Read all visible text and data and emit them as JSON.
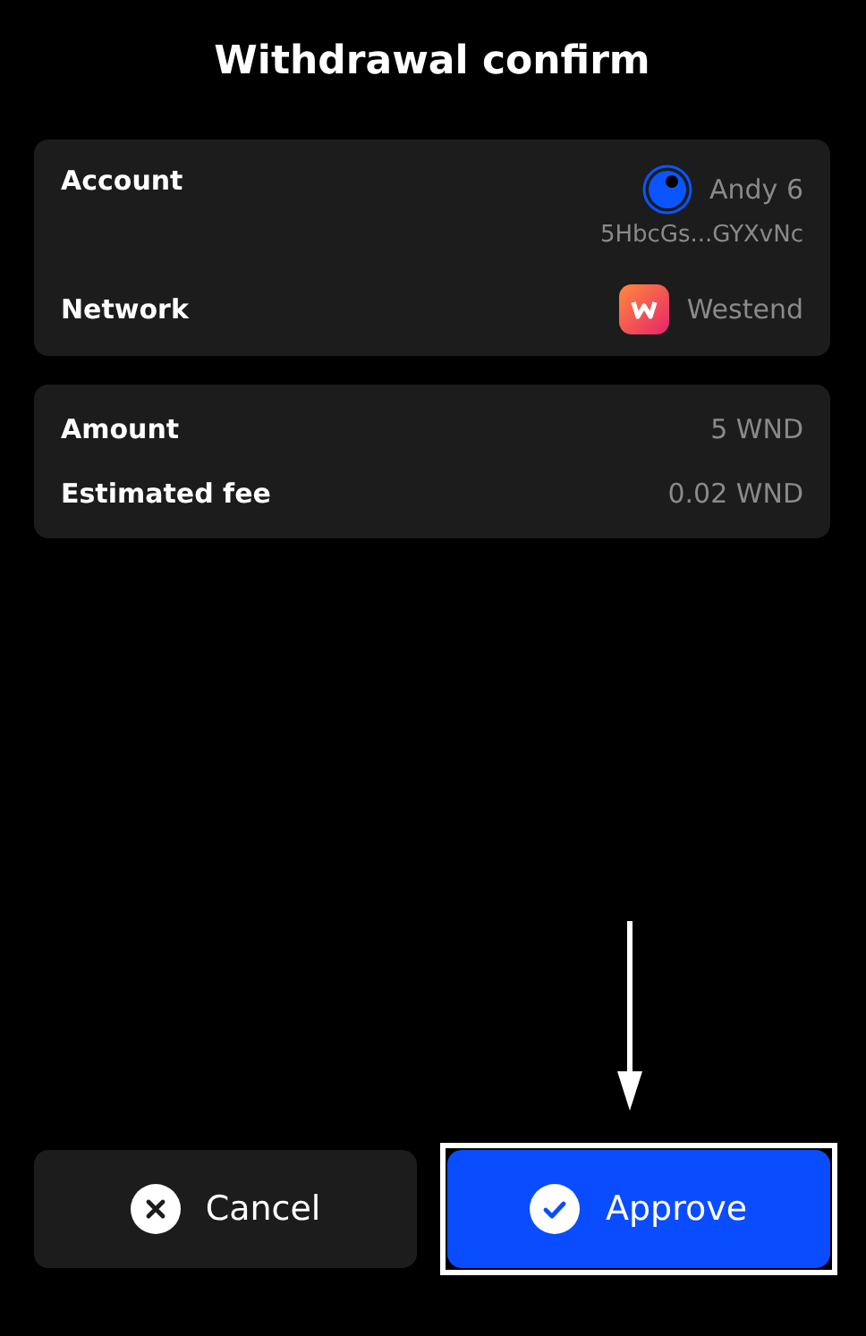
{
  "title": "Withdrawal confirm",
  "account_card": {
    "account_label": "Account",
    "account_name": "Andy 6",
    "account_address": "5HbcGs...GYXvNc",
    "network_label": "Network",
    "network_name": "Westend"
  },
  "amount_card": {
    "rows": [
      {
        "label": "Amount",
        "value": "5 WND"
      },
      {
        "label": "Estimated fee",
        "value": "0.02 WND"
      }
    ]
  },
  "buttons": [
    {
      "kind": "cancel",
      "label": "Cancel"
    },
    {
      "kind": "approve",
      "label": "Approve",
      "highlighted": true
    }
  ]
}
